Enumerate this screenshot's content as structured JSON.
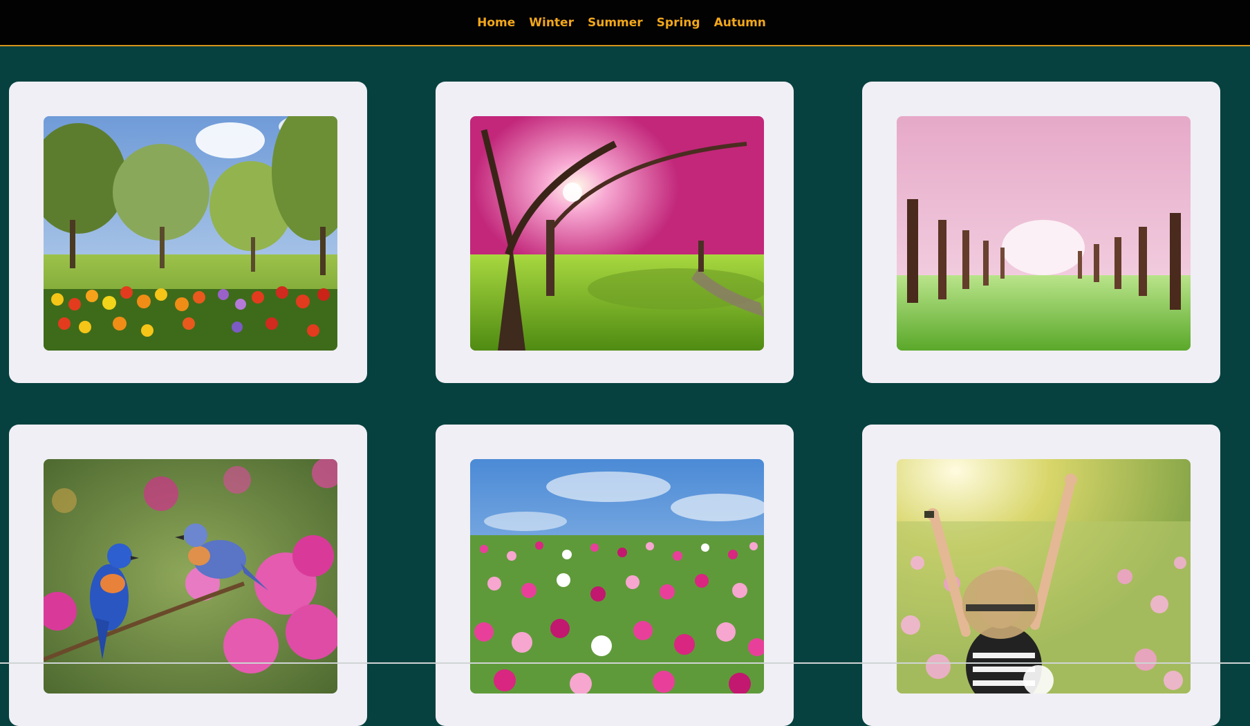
{
  "nav": {
    "items": [
      {
        "label": "Home"
      },
      {
        "label": "Winter"
      },
      {
        "label": "Summer"
      },
      {
        "label": "Spring"
      },
      {
        "label": "Autumn"
      }
    ]
  },
  "colors": {
    "background": "#06413f",
    "navbar": "#020202",
    "nav_text": "#f2a71b",
    "card": "#f0eff5"
  },
  "gallery": {
    "photos": [
      {
        "subject": "orchard-with-tulips"
      },
      {
        "subject": "pink-blossom-trees-with-sun"
      },
      {
        "subject": "cherry-blossom-avenue"
      },
      {
        "subject": "bluebirds-on-blossom-branch"
      },
      {
        "subject": "cosmos-flower-field-blue-sky"
      },
      {
        "subject": "woman-with-hat-in-flower-field"
      }
    ]
  }
}
